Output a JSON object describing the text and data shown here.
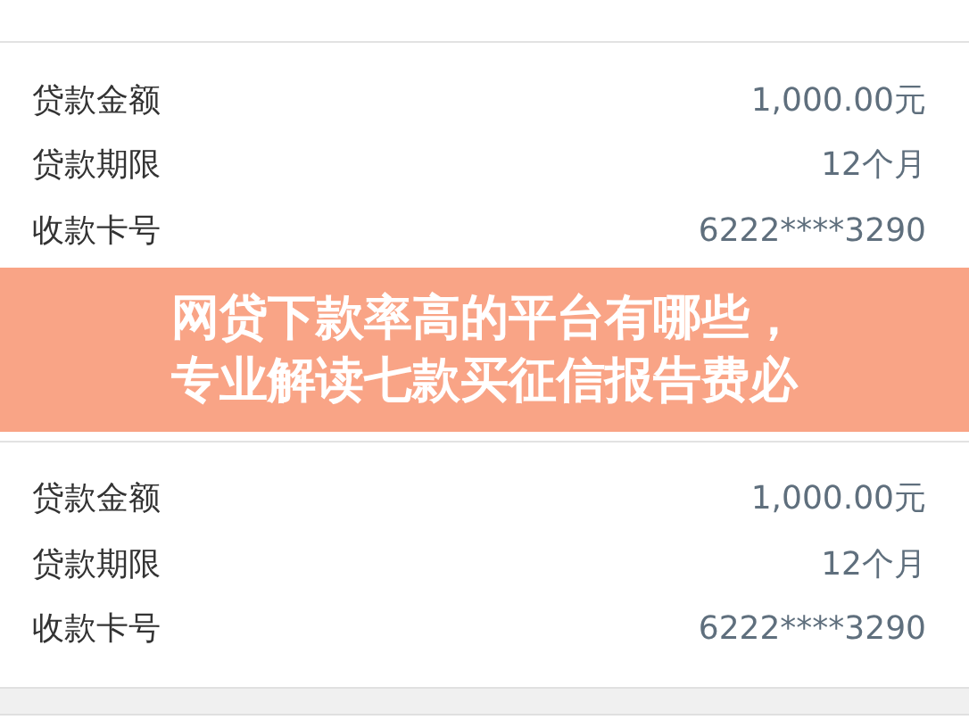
{
  "loans": [
    {
      "rows": [
        {
          "label": "贷款金额",
          "value": "1,000.00元"
        },
        {
          "label": "贷款期限",
          "value": "12个月"
        },
        {
          "label": "收款卡号",
          "value": "6222****3290"
        }
      ]
    },
    {
      "rows": [
        {
          "label": "贷款金额",
          "value": "1,000.00元"
        },
        {
          "label": "贷款期限",
          "value": "12个月"
        },
        {
          "label": "收款卡号",
          "value": "6222****3290"
        }
      ]
    }
  ],
  "banner": {
    "lines": [
      "网贷下款率高的平台有哪些，",
      "专业解读七款买征信报告费必"
    ]
  }
}
